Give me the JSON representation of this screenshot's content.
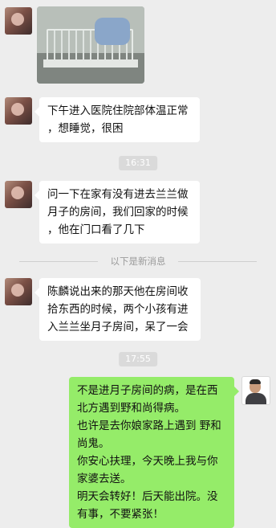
{
  "messages": [
    {
      "text": "下午进入医院住院部体温正常\n，想睡觉，很困"
    },
    {
      "text": "问一下在家有没有进去兰兰做\n月子的房间，我们回家的时候\n，他在门口看了几下"
    },
    {
      "text": "陈麟说出来的那天他在房间收\n拾东西的时候，两个小孩有进\n入兰兰坐月子房间，呆了一会"
    },
    {
      "text": "不是进月子房间的病，是在西\n北方遇到野和尚得病。\n也许是去你娘家路上遇到 野和\n尚鬼。\n你安心扶理，今天晚上我与你\n家婆去送。\n明天会转好！后天能出院。没\n有事，不要紧张！"
    }
  ],
  "timestamps": [
    "16:31",
    "17:55"
  ],
  "divider_text": "以下是新消息",
  "colors": {
    "background": "#ededed",
    "bubble_received": "#ffffff",
    "bubble_sent": "#95ec69"
  },
  "icons": [
    "hospital-bed-photo",
    "avatar-child",
    "avatar-man"
  ]
}
